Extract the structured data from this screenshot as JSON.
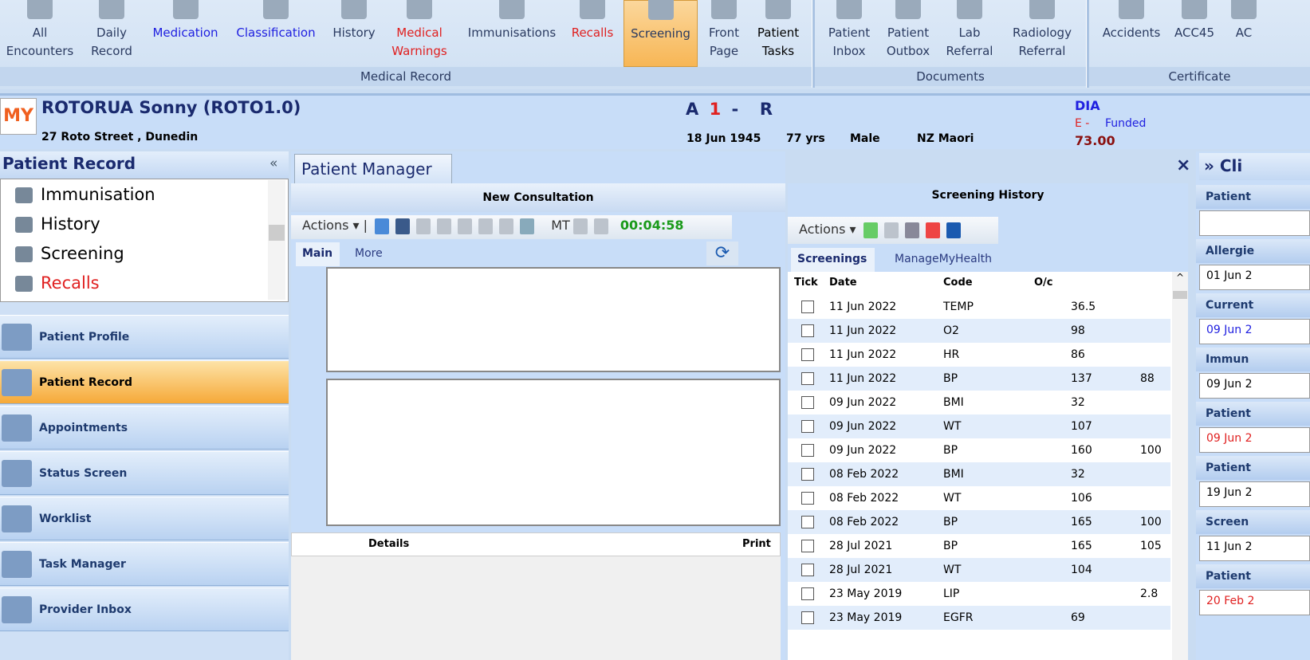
{
  "ribbon": {
    "items": [
      {
        "label": "All\nEncounters",
        "icon": "stethoscope-icon",
        "color": "#2a3a60"
      },
      {
        "label": "Daily\nRecord",
        "icon": "clock-arrow-icon",
        "color": "#2a3a60"
      },
      {
        "label": "Medication",
        "icon": "pill-icon",
        "color": "#2020e0"
      },
      {
        "label": "Classification",
        "icon": "dx-icon",
        "color": "#2020e0"
      },
      {
        "label": "History",
        "icon": "notebook-icon",
        "color": "#2a3a60"
      },
      {
        "label": "Medical\nWarnings",
        "icon": "medical-warning-icon",
        "color": "#e02020"
      },
      {
        "label": "Immunisations",
        "icon": "syringe-icon",
        "color": "#2a3a60"
      },
      {
        "label": "Recalls",
        "icon": "recall-icon",
        "color": "#e02020"
      },
      {
        "label": "Screening",
        "icon": "monitor-icon",
        "color": "#2a3a60"
      },
      {
        "label": "Front\nPage",
        "icon": "front-page-icon",
        "color": "#2a3a60"
      },
      {
        "label": "Patient\nTasks",
        "icon": "lightbulb-icon",
        "color": "#000"
      },
      {
        "label": "Patient\nInbox",
        "icon": "inbox-folder-icon",
        "color": "#2a3a60"
      },
      {
        "label": "Patient\nOutbox",
        "icon": "outbox-folder-icon",
        "color": "#2a3a60"
      },
      {
        "label": "Lab\nReferral",
        "icon": "test-tubes-icon",
        "color": "#2a3a60"
      },
      {
        "label": "Radiology\nReferral",
        "icon": "xray-icon",
        "color": "#2a3a60"
      },
      {
        "label": "Accidents",
        "icon": "bandaged-hand-icon",
        "color": "#2a3a60"
      },
      {
        "label": "ACC45",
        "icon": "acc45-icon",
        "color": "#2a3a60"
      },
      {
        "label": "AC",
        "icon": "certificate-icon",
        "color": "#2a3a60"
      }
    ],
    "groups": [
      "Medical Record",
      "Documents",
      "Certificate"
    ]
  },
  "patient": {
    "name": "ROTORUA Sonny (ROTO1.0)",
    "address": "27 Roto Street , Dunedin",
    "code_a": "A",
    "code_1": "1",
    "code_dash": "-",
    "code_r": "R",
    "dob": "18 Jun 1945",
    "age": "77 yrs",
    "sex": "Male",
    "ethnicity": "NZ Maori",
    "dia": "DIA",
    "e_status": "E -",
    "funded": "Funded",
    "amount": "73.00",
    "logo": "MANAGE MY HEALTH"
  },
  "left": {
    "title": "Patient Record",
    "collapse": "«",
    "tree": [
      {
        "label": "Immunisation",
        "color": "#000"
      },
      {
        "label": "History",
        "color": "#000"
      },
      {
        "label": "Screening",
        "color": "#000"
      },
      {
        "label": "Recalls",
        "color": "#e02020"
      }
    ],
    "nav": [
      "Patient Profile",
      "Patient Record",
      "Appointments",
      "Status Screen",
      "Worklist",
      "Task Manager",
      "Provider Inbox"
    ]
  },
  "center": {
    "tab": "Patient Manager",
    "close": "×",
    "title": "New Consultation",
    "actions": "Actions ▾",
    "mt": "MT",
    "timer": "00:04:58",
    "subtabs": [
      "Main",
      "More"
    ],
    "cols": [
      "Details",
      "Print"
    ]
  },
  "screening": {
    "title": "Screening History",
    "actions": "Actions ▾",
    "tabs": [
      "Screenings",
      "ManageMyHealth"
    ],
    "cols": [
      "Tick",
      "Date",
      "Code",
      "O/c"
    ],
    "rows": [
      [
        "11 Jun 2022",
        "TEMP",
        "",
        "36.5",
        ""
      ],
      [
        "11 Jun 2022",
        "O2",
        "",
        "98",
        ""
      ],
      [
        "11 Jun 2022",
        "HR",
        "",
        "86",
        ""
      ],
      [
        "11 Jun 2022",
        "BP",
        "",
        "137",
        "88"
      ],
      [
        "09 Jun 2022",
        "BMI",
        "",
        "32",
        ""
      ],
      [
        "09 Jun 2022",
        "WT",
        "",
        "107",
        ""
      ],
      [
        "09 Jun 2022",
        "BP",
        "",
        "160",
        "100"
      ],
      [
        "08 Feb 2022",
        "BMI",
        "",
        "32",
        ""
      ],
      [
        "08 Feb 2022",
        "WT",
        "",
        "106",
        ""
      ],
      [
        "08 Feb 2022",
        "BP",
        "",
        "165",
        "100"
      ],
      [
        "28 Jul 2021",
        "BP",
        "",
        "165",
        "105"
      ],
      [
        "28 Jul 2021",
        "WT",
        "",
        "104",
        ""
      ],
      [
        "23 May 2019",
        "LIP",
        "",
        "",
        "2.8"
      ],
      [
        "23 May 2019",
        "EGFR",
        "",
        "69",
        ""
      ]
    ]
  },
  "right": {
    "title": "» Cli",
    "sections": [
      {
        "label": "Patient",
        "value": "",
        "color": "#000"
      },
      {
        "label": "Allergie",
        "value": "01 Jun 2",
        "color": "#000"
      },
      {
        "label": "Current",
        "value": "09 Jun 2",
        "color": "#2020e0"
      },
      {
        "label": "Immun",
        "value": "09 Jun 2",
        "color": "#000"
      },
      {
        "label": "Patient",
        "value": "09 Jun 2",
        "color": "#e02020"
      },
      {
        "label": "Patient",
        "value": "19 Jun 2",
        "color": "#000"
      },
      {
        "label": "Screen",
        "value": "11 Jun 2",
        "color": "#000"
      },
      {
        "label": "Patient",
        "value": "20 Feb 2",
        "color": "#e02020"
      }
    ]
  }
}
